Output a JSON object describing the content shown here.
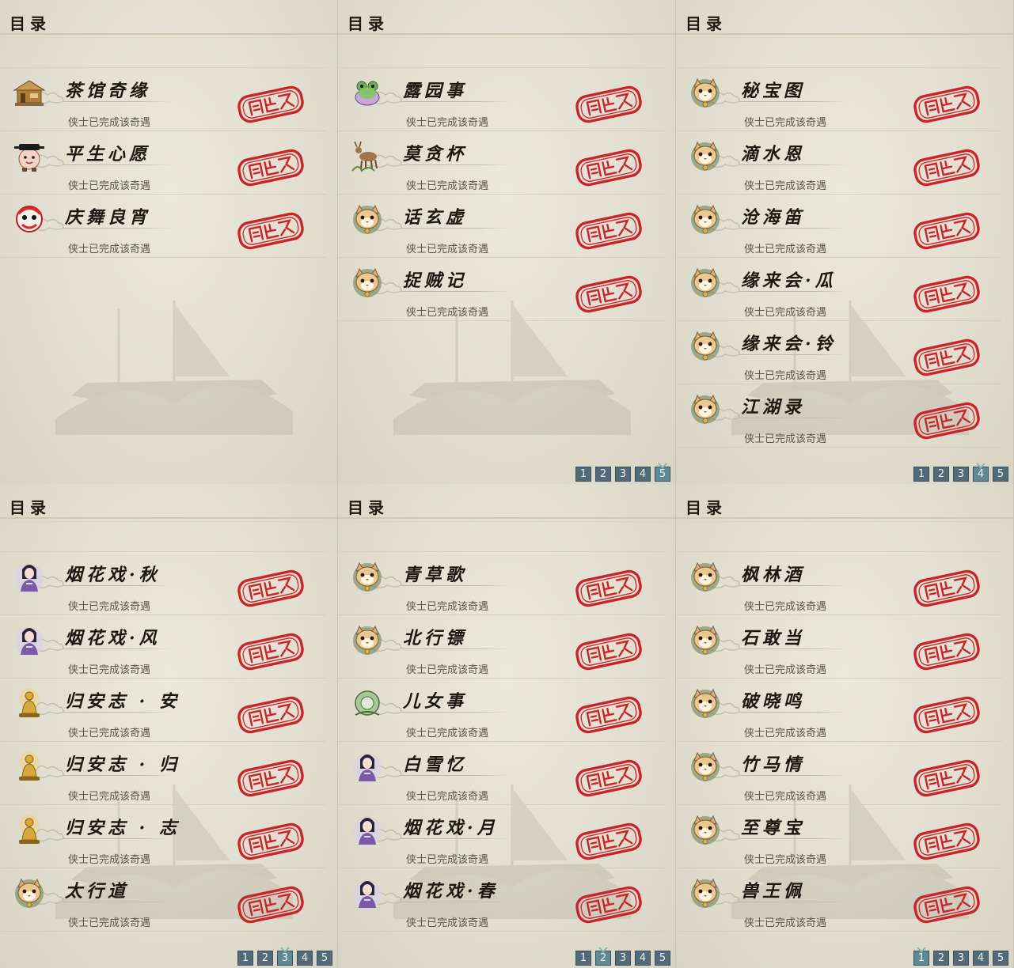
{
  "panels": [
    {
      "title": "目录",
      "entries": [
        {
          "name": "茶馆奇缘",
          "status": "侠士已完成该奇遇",
          "icon": "teahouse-icon"
        },
        {
          "name": "平生心愿",
          "status": "侠士已完成该奇遇",
          "icon": "official-icon"
        },
        {
          "name": "庆舞良宵",
          "status": "侠士已完成该奇遇",
          "icon": "lion-dance-icon"
        }
      ],
      "pager": []
    },
    {
      "title": "目录",
      "entries": [
        {
          "name": "露园事",
          "status": "侠士已完成该奇遇",
          "icon": "frog-icon"
        },
        {
          "name": "莫贪杯",
          "status": "侠士已完成该奇遇",
          "icon": "deer-icon"
        },
        {
          "name": "话玄虚",
          "status": "侠士已完成该奇遇",
          "icon": "cat-icon"
        },
        {
          "name": "捉贼记",
          "status": "侠士已完成该奇遇",
          "icon": "cat-icon"
        }
      ],
      "pager": [
        "1",
        "2",
        "3",
        "4",
        "5"
      ],
      "active_page": "5"
    },
    {
      "title": "目录",
      "entries": [
        {
          "name": "秘宝图",
          "status": "侠士已完成该奇遇",
          "icon": "cat-icon"
        },
        {
          "name": "滴水恩",
          "status": "侠士已完成该奇遇",
          "icon": "cat-icon"
        },
        {
          "name": "沧海笛",
          "status": "侠士已完成该奇遇",
          "icon": "cat-icon"
        },
        {
          "name": "缘来会·瓜",
          "status": "侠士已完成该奇遇",
          "icon": "cat-icon"
        },
        {
          "name": "缘来会·铃",
          "status": "侠士已完成该奇遇",
          "icon": "cat-icon"
        },
        {
          "name": "江湖录",
          "status": "侠士已完成该奇遇",
          "icon": "cat-icon"
        }
      ],
      "pager": [
        "1",
        "2",
        "3",
        "4",
        "5"
      ],
      "active_page": "4"
    },
    {
      "title": "目录",
      "entries": [
        {
          "name": "烟花戏·秋",
          "status": "侠士已完成该奇遇",
          "icon": "lady-icon"
        },
        {
          "name": "烟花戏·风",
          "status": "侠士已完成该奇遇",
          "icon": "lady-icon"
        },
        {
          "name": "归安志 · 安",
          "status": "侠士已完成该奇遇",
          "icon": "buddha-icon"
        },
        {
          "name": "归安志 · 归",
          "status": "侠士已完成该奇遇",
          "icon": "buddha-icon"
        },
        {
          "name": "归安志 · 志",
          "status": "侠士已完成该奇遇",
          "icon": "buddha-icon"
        },
        {
          "name": "太行道",
          "status": "侠士已完成该奇遇",
          "icon": "cat-icon"
        }
      ],
      "pager": [
        "1",
        "2",
        "3",
        "4",
        "5"
      ],
      "active_page": "3"
    },
    {
      "title": "目录",
      "entries": [
        {
          "name": "青草歌",
          "status": "侠士已完成该奇遇",
          "icon": "cat-icon"
        },
        {
          "name": "北行镖",
          "status": "侠士已完成该奇遇",
          "icon": "cat-icon"
        },
        {
          "name": "儿女事",
          "status": "侠士已完成该奇遇",
          "icon": "jade-icon"
        },
        {
          "name": "白雪忆",
          "status": "侠士已完成该奇遇",
          "icon": "lady-icon"
        },
        {
          "name": "烟花戏·月",
          "status": "侠士已完成该奇遇",
          "icon": "lady-icon"
        },
        {
          "name": "烟花戏·春",
          "status": "侠士已完成该奇遇",
          "icon": "lady-icon"
        }
      ],
      "pager": [
        "1",
        "2",
        "3",
        "4",
        "5"
      ],
      "active_page": "2"
    },
    {
      "title": "目录",
      "entries": [
        {
          "name": "枫林酒",
          "status": "侠士已完成该奇遇",
          "icon": "cat-icon"
        },
        {
          "name": "石敢当",
          "status": "侠士已完成该奇遇",
          "icon": "cat-icon"
        },
        {
          "name": "破晓鸣",
          "status": "侠士已完成该奇遇",
          "icon": "cat-icon"
        },
        {
          "name": "竹马情",
          "status": "侠士已完成该奇遇",
          "icon": "cat-icon"
        },
        {
          "name": "至尊宝",
          "status": "侠士已完成该奇遇",
          "icon": "cat-icon"
        },
        {
          "name": "兽王佩",
          "status": "侠士已完成该奇遇",
          "icon": "cat-icon"
        }
      ],
      "pager": [
        "1",
        "2",
        "3",
        "4",
        "5"
      ],
      "active_page": "1"
    }
  ],
  "colors": {
    "stamp": "#c8242a",
    "pager_bg": "#536a79",
    "pager_active": "#5f8a93"
  }
}
